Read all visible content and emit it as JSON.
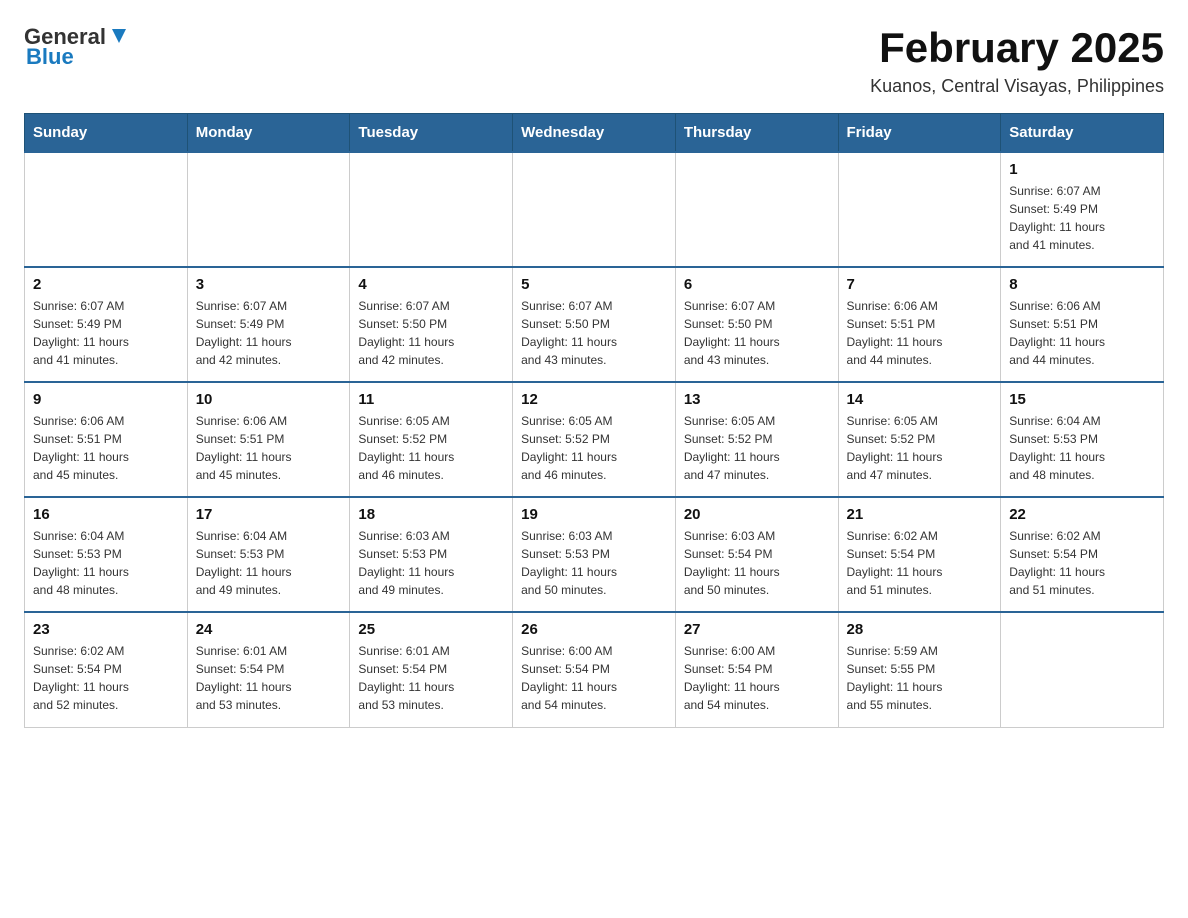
{
  "header": {
    "logo_general": "General",
    "logo_blue": "Blue",
    "title": "February 2025",
    "location": "Kuanos, Central Visayas, Philippines"
  },
  "weekdays": [
    "Sunday",
    "Monday",
    "Tuesday",
    "Wednesday",
    "Thursday",
    "Friday",
    "Saturday"
  ],
  "weeks": [
    [
      {
        "day": "",
        "info": ""
      },
      {
        "day": "",
        "info": ""
      },
      {
        "day": "",
        "info": ""
      },
      {
        "day": "",
        "info": ""
      },
      {
        "day": "",
        "info": ""
      },
      {
        "day": "",
        "info": ""
      },
      {
        "day": "1",
        "info": "Sunrise: 6:07 AM\nSunset: 5:49 PM\nDaylight: 11 hours\nand 41 minutes."
      }
    ],
    [
      {
        "day": "2",
        "info": "Sunrise: 6:07 AM\nSunset: 5:49 PM\nDaylight: 11 hours\nand 41 minutes."
      },
      {
        "day": "3",
        "info": "Sunrise: 6:07 AM\nSunset: 5:49 PM\nDaylight: 11 hours\nand 42 minutes."
      },
      {
        "day": "4",
        "info": "Sunrise: 6:07 AM\nSunset: 5:50 PM\nDaylight: 11 hours\nand 42 minutes."
      },
      {
        "day": "5",
        "info": "Sunrise: 6:07 AM\nSunset: 5:50 PM\nDaylight: 11 hours\nand 43 minutes."
      },
      {
        "day": "6",
        "info": "Sunrise: 6:07 AM\nSunset: 5:50 PM\nDaylight: 11 hours\nand 43 minutes."
      },
      {
        "day": "7",
        "info": "Sunrise: 6:06 AM\nSunset: 5:51 PM\nDaylight: 11 hours\nand 44 minutes."
      },
      {
        "day": "8",
        "info": "Sunrise: 6:06 AM\nSunset: 5:51 PM\nDaylight: 11 hours\nand 44 minutes."
      }
    ],
    [
      {
        "day": "9",
        "info": "Sunrise: 6:06 AM\nSunset: 5:51 PM\nDaylight: 11 hours\nand 45 minutes."
      },
      {
        "day": "10",
        "info": "Sunrise: 6:06 AM\nSunset: 5:51 PM\nDaylight: 11 hours\nand 45 minutes."
      },
      {
        "day": "11",
        "info": "Sunrise: 6:05 AM\nSunset: 5:52 PM\nDaylight: 11 hours\nand 46 minutes."
      },
      {
        "day": "12",
        "info": "Sunrise: 6:05 AM\nSunset: 5:52 PM\nDaylight: 11 hours\nand 46 minutes."
      },
      {
        "day": "13",
        "info": "Sunrise: 6:05 AM\nSunset: 5:52 PM\nDaylight: 11 hours\nand 47 minutes."
      },
      {
        "day": "14",
        "info": "Sunrise: 6:05 AM\nSunset: 5:52 PM\nDaylight: 11 hours\nand 47 minutes."
      },
      {
        "day": "15",
        "info": "Sunrise: 6:04 AM\nSunset: 5:53 PM\nDaylight: 11 hours\nand 48 minutes."
      }
    ],
    [
      {
        "day": "16",
        "info": "Sunrise: 6:04 AM\nSunset: 5:53 PM\nDaylight: 11 hours\nand 48 minutes."
      },
      {
        "day": "17",
        "info": "Sunrise: 6:04 AM\nSunset: 5:53 PM\nDaylight: 11 hours\nand 49 minutes."
      },
      {
        "day": "18",
        "info": "Sunrise: 6:03 AM\nSunset: 5:53 PM\nDaylight: 11 hours\nand 49 minutes."
      },
      {
        "day": "19",
        "info": "Sunrise: 6:03 AM\nSunset: 5:53 PM\nDaylight: 11 hours\nand 50 minutes."
      },
      {
        "day": "20",
        "info": "Sunrise: 6:03 AM\nSunset: 5:54 PM\nDaylight: 11 hours\nand 50 minutes."
      },
      {
        "day": "21",
        "info": "Sunrise: 6:02 AM\nSunset: 5:54 PM\nDaylight: 11 hours\nand 51 minutes."
      },
      {
        "day": "22",
        "info": "Sunrise: 6:02 AM\nSunset: 5:54 PM\nDaylight: 11 hours\nand 51 minutes."
      }
    ],
    [
      {
        "day": "23",
        "info": "Sunrise: 6:02 AM\nSunset: 5:54 PM\nDaylight: 11 hours\nand 52 minutes."
      },
      {
        "day": "24",
        "info": "Sunrise: 6:01 AM\nSunset: 5:54 PM\nDaylight: 11 hours\nand 53 minutes."
      },
      {
        "day": "25",
        "info": "Sunrise: 6:01 AM\nSunset: 5:54 PM\nDaylight: 11 hours\nand 53 minutes."
      },
      {
        "day": "26",
        "info": "Sunrise: 6:00 AM\nSunset: 5:54 PM\nDaylight: 11 hours\nand 54 minutes."
      },
      {
        "day": "27",
        "info": "Sunrise: 6:00 AM\nSunset: 5:54 PM\nDaylight: 11 hours\nand 54 minutes."
      },
      {
        "day": "28",
        "info": "Sunrise: 5:59 AM\nSunset: 5:55 PM\nDaylight: 11 hours\nand 55 minutes."
      },
      {
        "day": "",
        "info": ""
      }
    ]
  ]
}
